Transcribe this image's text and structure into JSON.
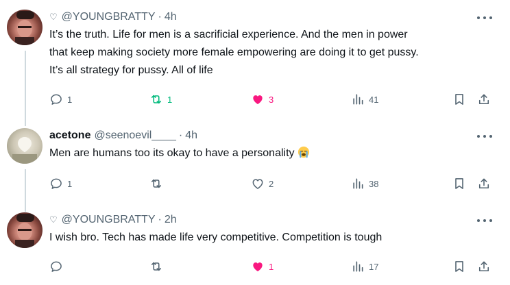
{
  "tweets": [
    {
      "display_name": "",
      "handle": "@YOUNGBRATTY",
      "time": "4h",
      "text_lines": [
        "It’s the truth. Life for men is a sacrificial experience. And the men in power",
        "that keep making society more female empowering are doing it to get pussy.",
        "It’s all strategy for pussy. All of life"
      ],
      "replies": "1",
      "reposts": "1",
      "likes": "3",
      "views": "41",
      "reposted": true,
      "liked": true
    },
    {
      "display_name": "acetone",
      "handle": "@seenoevil____",
      "time": "4h",
      "text_lines": [
        "Men are humans too its okay to have a personality"
      ],
      "emoji": "loudly-crying-face",
      "replies": "1",
      "reposts": "",
      "likes": "2",
      "views": "38",
      "reposted": false,
      "liked": false
    },
    {
      "display_name": "",
      "handle": "@YOUNGBRATTY",
      "time": "2h",
      "text_lines": [
        "I wish bro. Tech has made life very competitive. Competition is tough"
      ],
      "replies": "",
      "reposts": "",
      "likes": "1",
      "views": "17",
      "reposted": false,
      "liked": true
    }
  ],
  "colors": {
    "like_active": "#f91880",
    "repost_active": "#00ba7c",
    "muted": "#536471",
    "line": "#cfd9de"
  },
  "icons": [
    "heart-small-icon",
    "more-icon",
    "reply-icon",
    "repost-icon",
    "like-icon",
    "views-icon",
    "bookmark-icon",
    "share-icon",
    "loudly-crying-face-emoji"
  ]
}
